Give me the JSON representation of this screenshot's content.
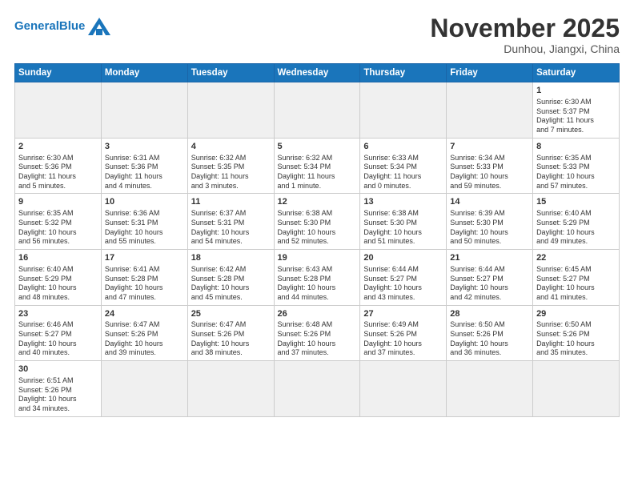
{
  "header": {
    "logo_general": "General",
    "logo_blue": "Blue",
    "month": "November 2025",
    "location": "Dunhou, Jiangxi, China"
  },
  "days_of_week": [
    "Sunday",
    "Monday",
    "Tuesday",
    "Wednesday",
    "Thursday",
    "Friday",
    "Saturday"
  ],
  "weeks": [
    [
      {
        "day": "",
        "content": "",
        "empty": true
      },
      {
        "day": "",
        "content": "",
        "empty": true
      },
      {
        "day": "",
        "content": "",
        "empty": true
      },
      {
        "day": "",
        "content": "",
        "empty": true
      },
      {
        "day": "",
        "content": "",
        "empty": true
      },
      {
        "day": "",
        "content": "",
        "empty": true
      },
      {
        "day": "1",
        "content": "Sunrise: 6:30 AM\nSunset: 5:37 PM\nDaylight: 11 hours\nand 7 minutes.",
        "empty": false
      }
    ],
    [
      {
        "day": "2",
        "content": "Sunrise: 6:30 AM\nSunset: 5:36 PM\nDaylight: 11 hours\nand 5 minutes.",
        "empty": false
      },
      {
        "day": "3",
        "content": "Sunrise: 6:31 AM\nSunset: 5:36 PM\nDaylight: 11 hours\nand 4 minutes.",
        "empty": false
      },
      {
        "day": "4",
        "content": "Sunrise: 6:32 AM\nSunset: 5:35 PM\nDaylight: 11 hours\nand 3 minutes.",
        "empty": false
      },
      {
        "day": "5",
        "content": "Sunrise: 6:32 AM\nSunset: 5:34 PM\nDaylight: 11 hours\nand 1 minute.",
        "empty": false
      },
      {
        "day": "6",
        "content": "Sunrise: 6:33 AM\nSunset: 5:34 PM\nDaylight: 11 hours\nand 0 minutes.",
        "empty": false
      },
      {
        "day": "7",
        "content": "Sunrise: 6:34 AM\nSunset: 5:33 PM\nDaylight: 10 hours\nand 59 minutes.",
        "empty": false
      },
      {
        "day": "8",
        "content": "Sunrise: 6:35 AM\nSunset: 5:33 PM\nDaylight: 10 hours\nand 57 minutes.",
        "empty": false
      }
    ],
    [
      {
        "day": "9",
        "content": "Sunrise: 6:35 AM\nSunset: 5:32 PM\nDaylight: 10 hours\nand 56 minutes.",
        "empty": false
      },
      {
        "day": "10",
        "content": "Sunrise: 6:36 AM\nSunset: 5:31 PM\nDaylight: 10 hours\nand 55 minutes.",
        "empty": false
      },
      {
        "day": "11",
        "content": "Sunrise: 6:37 AM\nSunset: 5:31 PM\nDaylight: 10 hours\nand 54 minutes.",
        "empty": false
      },
      {
        "day": "12",
        "content": "Sunrise: 6:38 AM\nSunset: 5:30 PM\nDaylight: 10 hours\nand 52 minutes.",
        "empty": false
      },
      {
        "day": "13",
        "content": "Sunrise: 6:38 AM\nSunset: 5:30 PM\nDaylight: 10 hours\nand 51 minutes.",
        "empty": false
      },
      {
        "day": "14",
        "content": "Sunrise: 6:39 AM\nSunset: 5:30 PM\nDaylight: 10 hours\nand 50 minutes.",
        "empty": false
      },
      {
        "day": "15",
        "content": "Sunrise: 6:40 AM\nSunset: 5:29 PM\nDaylight: 10 hours\nand 49 minutes.",
        "empty": false
      }
    ],
    [
      {
        "day": "16",
        "content": "Sunrise: 6:40 AM\nSunset: 5:29 PM\nDaylight: 10 hours\nand 48 minutes.",
        "empty": false
      },
      {
        "day": "17",
        "content": "Sunrise: 6:41 AM\nSunset: 5:28 PM\nDaylight: 10 hours\nand 47 minutes.",
        "empty": false
      },
      {
        "day": "18",
        "content": "Sunrise: 6:42 AM\nSunset: 5:28 PM\nDaylight: 10 hours\nand 45 minutes.",
        "empty": false
      },
      {
        "day": "19",
        "content": "Sunrise: 6:43 AM\nSunset: 5:28 PM\nDaylight: 10 hours\nand 44 minutes.",
        "empty": false
      },
      {
        "day": "20",
        "content": "Sunrise: 6:44 AM\nSunset: 5:27 PM\nDaylight: 10 hours\nand 43 minutes.",
        "empty": false
      },
      {
        "day": "21",
        "content": "Sunrise: 6:44 AM\nSunset: 5:27 PM\nDaylight: 10 hours\nand 42 minutes.",
        "empty": false
      },
      {
        "day": "22",
        "content": "Sunrise: 6:45 AM\nSunset: 5:27 PM\nDaylight: 10 hours\nand 41 minutes.",
        "empty": false
      }
    ],
    [
      {
        "day": "23",
        "content": "Sunrise: 6:46 AM\nSunset: 5:27 PM\nDaylight: 10 hours\nand 40 minutes.",
        "empty": false
      },
      {
        "day": "24",
        "content": "Sunrise: 6:47 AM\nSunset: 5:26 PM\nDaylight: 10 hours\nand 39 minutes.",
        "empty": false
      },
      {
        "day": "25",
        "content": "Sunrise: 6:47 AM\nSunset: 5:26 PM\nDaylight: 10 hours\nand 38 minutes.",
        "empty": false
      },
      {
        "day": "26",
        "content": "Sunrise: 6:48 AM\nSunset: 5:26 PM\nDaylight: 10 hours\nand 37 minutes.",
        "empty": false
      },
      {
        "day": "27",
        "content": "Sunrise: 6:49 AM\nSunset: 5:26 PM\nDaylight: 10 hours\nand 37 minutes.",
        "empty": false
      },
      {
        "day": "28",
        "content": "Sunrise: 6:50 AM\nSunset: 5:26 PM\nDaylight: 10 hours\nand 36 minutes.",
        "empty": false
      },
      {
        "day": "29",
        "content": "Sunrise: 6:50 AM\nSunset: 5:26 PM\nDaylight: 10 hours\nand 35 minutes.",
        "empty": false
      }
    ],
    [
      {
        "day": "30",
        "content": "Sunrise: 6:51 AM\nSunset: 5:26 PM\nDaylight: 10 hours\nand 34 minutes.",
        "empty": false
      },
      {
        "day": "",
        "content": "",
        "empty": true
      },
      {
        "day": "",
        "content": "",
        "empty": true
      },
      {
        "day": "",
        "content": "",
        "empty": true
      },
      {
        "day": "",
        "content": "",
        "empty": true
      },
      {
        "day": "",
        "content": "",
        "empty": true
      },
      {
        "day": "",
        "content": "",
        "empty": true
      }
    ]
  ]
}
